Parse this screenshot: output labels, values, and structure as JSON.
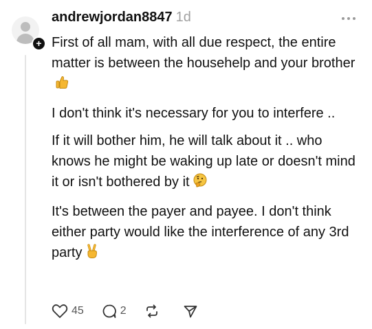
{
  "post": {
    "username": "andrewjordan8847",
    "timestamp": "1d",
    "paragraphs": [
      "First of all mam, with all due respect, the entire matter is between the househelp and your brother",
      "I don't think it's necessary for you to interfere ..",
      "If it will bother him, he will talk about it .. who knows he might be waking up late or doesn't mind it or isn't bothered by it",
      "It's between the payer and payee. I don't think either party would like the interference of any 3rd party"
    ],
    "emojis": [
      "thumbs-up-emoji",
      "thinking-face-emoji",
      "victory-hand-emoji"
    ]
  },
  "actions": {
    "like_count": "45",
    "reply_count": "2"
  },
  "icons": {
    "avatar": "default-avatar-icon",
    "follow": "plus-icon",
    "more": "more-horizontal-icon",
    "like": "heart-icon",
    "reply": "comment-bubble-icon",
    "repost": "repost-icon",
    "share": "send-icon"
  },
  "colors": {
    "text": "#101010",
    "muted": "#a0a0a0",
    "icon": "#555555",
    "thread_line": "#e4e4e4",
    "emoji": "#f5b731"
  }
}
